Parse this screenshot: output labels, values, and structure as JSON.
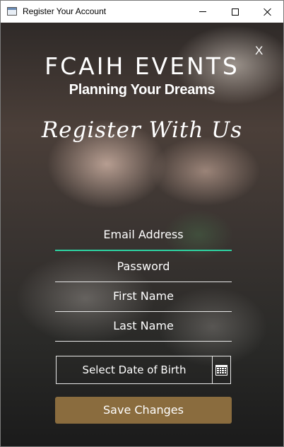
{
  "window": {
    "title": "Register Your Account",
    "controls": {
      "minimize_icon": "minimize-icon",
      "maximize_icon": "maximize-icon",
      "close_icon": "close-icon"
    }
  },
  "header": {
    "close_label": "X",
    "brand": "FCAIH EVENTS",
    "tagline": "Planning Your Dreams",
    "script_heading": "Register With Us"
  },
  "form": {
    "email_placeholder": "Email Address",
    "password_placeholder": "Password",
    "first_name_placeholder": "First Name",
    "last_name_placeholder": "Last Name",
    "dob_label": "Select Date of Birth",
    "calendar_icon": "calendar-icon",
    "save_label": "Save Changes"
  },
  "colors": {
    "accent_underline": "#2ed3a2",
    "save_button": "#8a6c3e"
  }
}
